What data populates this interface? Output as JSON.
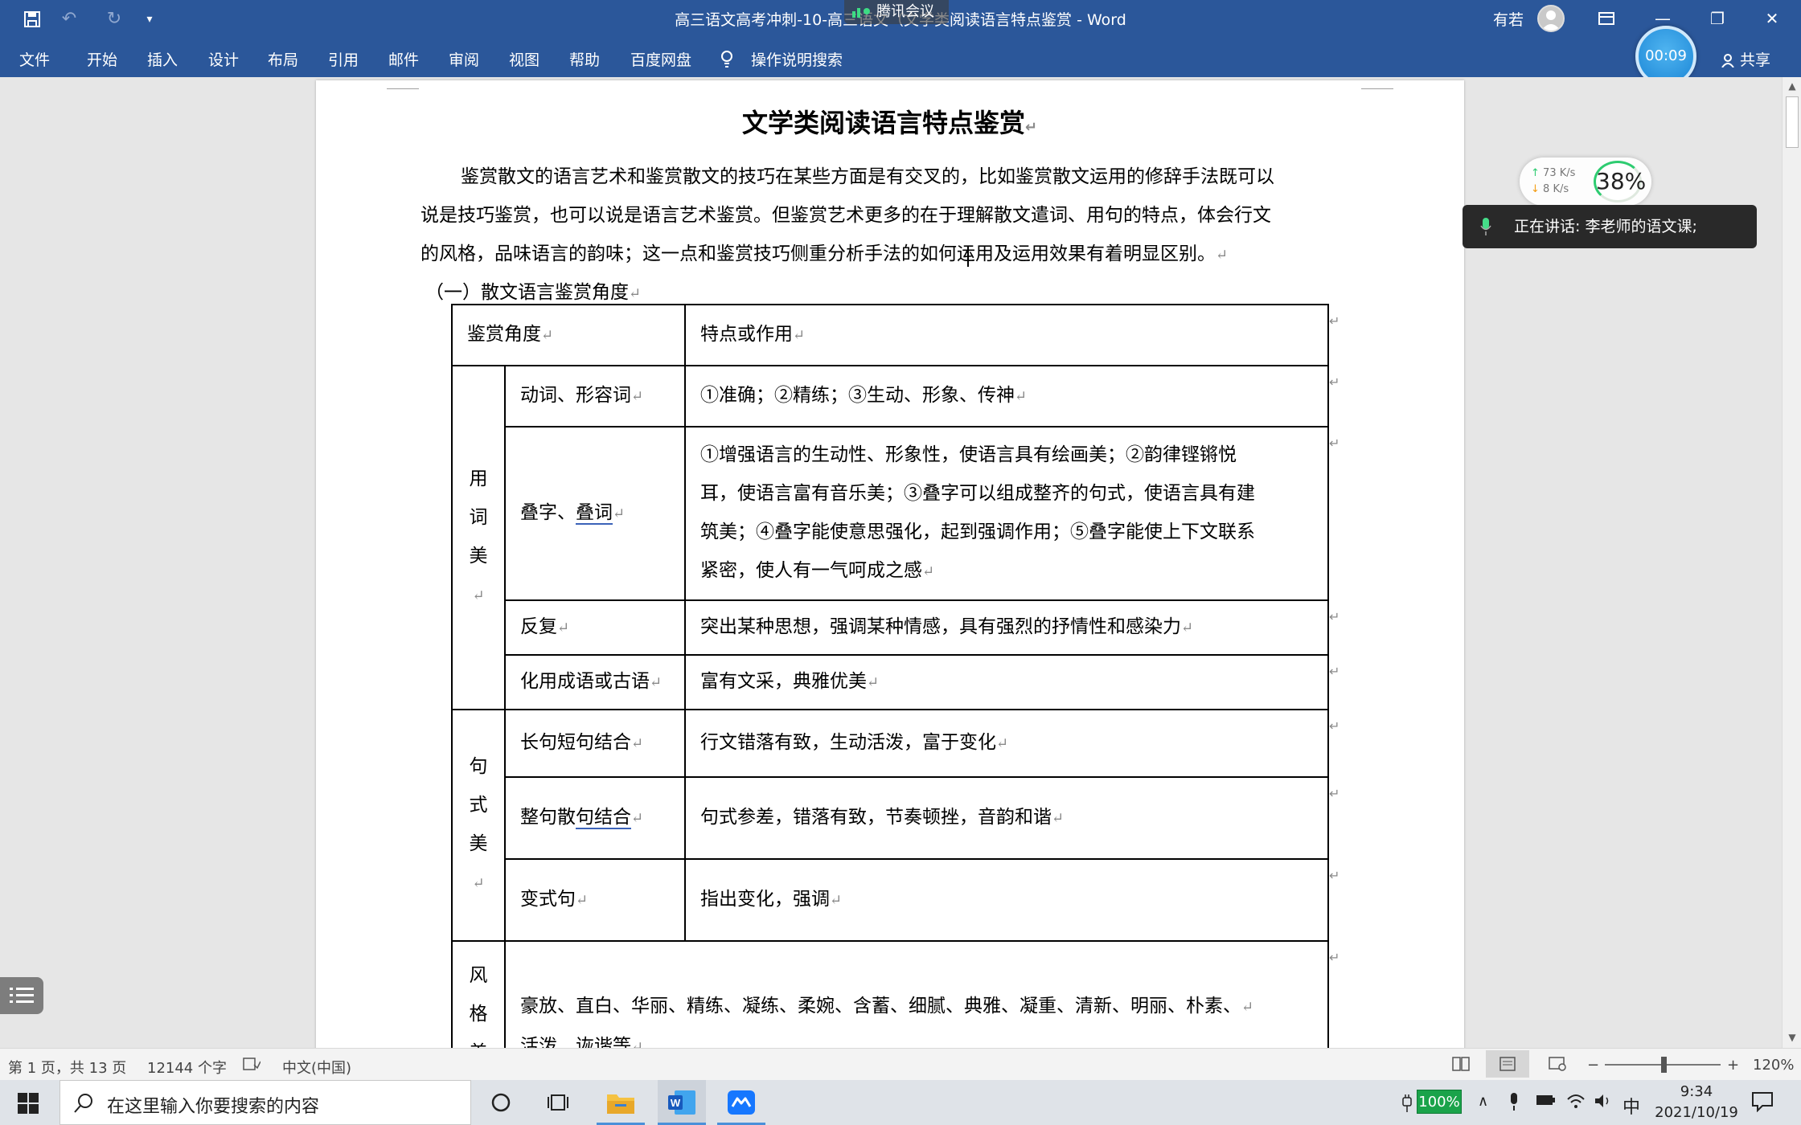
{
  "titlebar": {
    "doc_title": "高三语文高考冲刺-10-高三语文（文学类阅读语言特点鉴赏 - Word",
    "meeting": "腾讯会议",
    "user": "有若"
  },
  "ribbon": {
    "tabs": [
      "文件",
      "开始",
      "插入",
      "设计",
      "布局",
      "引用",
      "邮件",
      "审阅",
      "视图",
      "帮助",
      "百度网盘"
    ],
    "tell_me": "操作说明搜索",
    "share": "共享"
  },
  "timer": "00:09",
  "document": {
    "heading": "文学类阅读语言特点鉴赏",
    "para_lines": [
      "鉴赏散文的语言艺术和鉴赏散文的技巧在某些方面是有交叉的，比如鉴赏散文运用的修辞手法既可以",
      "说是技巧鉴赏，也可以说是语言艺术鉴赏。但鉴赏艺术更多的在于理解散文遣词、用句的特点，体会行文",
      "的风格，品味语言的韵味；这一点和鉴赏技巧侧重分析手法的如何运用及运用效果有着明显区别。"
    ],
    "section": "（一）散文语言鉴赏角度",
    "table": {
      "header": [
        "鉴赏角度",
        "特点或作用"
      ],
      "group1": "用词美",
      "g1_rows": [
        {
          "angle": "动词、形容词",
          "effect": [
            "①准确；②精练；③生动、形象、传神"
          ]
        },
        {
          "angle_a": "叠字、",
          "angle_b": "叠词",
          "effect": [
            "①增强语言的生动性、形象性，使语言具有绘画美；②韵律铿锵悦",
            "耳，使语言富有音乐美；③叠字可以组成整齐的句式，使语言具有建",
            "筑美；④叠字能使意思强化，起到强调作用；⑤叠字能使上下文联系",
            "紧密，使人有一气呵成之感"
          ]
        },
        {
          "angle": "反复",
          "effect": [
            "突出某种思想，强调某种情感，具有强烈的抒情性和感染力"
          ]
        },
        {
          "angle": "化用成语或古语",
          "effect": [
            "富有文采，典雅优美"
          ]
        }
      ],
      "group2": "句式美",
      "g2_rows": [
        {
          "angle": "长句短句结合",
          "effect": "行文错落有致，生动活泼，富于变化"
        },
        {
          "angle_a": "整句散",
          "angle_b": "句结合",
          "effect": "句式参差，错落有致，节奏顿挫，音韵和谐"
        },
        {
          "angle": "变式句",
          "effect": "指出变化，强调"
        }
      ],
      "group3": "风格美",
      "g3_lines": [
        "豪放、直白、华丽、精练、凝练、柔婉、含蓄、细腻、典雅、凝重、清新、明丽、朴素、",
        "活泼、诙谐等"
      ]
    }
  },
  "meeting_overlay": {
    "speaking": "正在讲话: 李老师的语文课;",
    "up_speed": "73  K/s",
    "down_speed": "8  K/s",
    "cpu": "38%"
  },
  "statusbar": {
    "page": "第 1 页，共 13 页",
    "words": "12144 个字",
    "lang": "中文(中国)",
    "zoom": "120%"
  },
  "taskbar": {
    "search_placeholder": "在这里输入你要搜索的内容",
    "battery": "100%",
    "ime": "中",
    "time": "9:34",
    "date": "2021/10/19"
  }
}
